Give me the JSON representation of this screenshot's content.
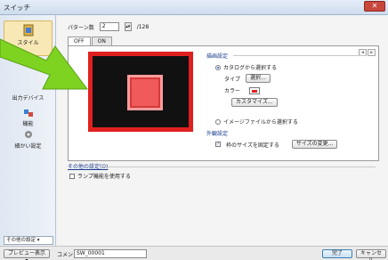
{
  "window": {
    "title": "スイッチ",
    "close_glyph": "✕"
  },
  "sidebar": {
    "items": [
      {
        "label": "スタイル",
        "icon": "style-icon"
      },
      {
        "label": "出力デバイス",
        "icon": "output-device-icon"
      },
      {
        "label": "機能",
        "icon": "function-icon"
      },
      {
        "label": "細かい設定",
        "icon": "gear-icon"
      }
    ],
    "footer": "その他の設定 ▾"
  },
  "pattern": {
    "label": "パターン数",
    "value": "2",
    "spin": "▴▾",
    "max": "/128"
  },
  "tabs": [
    "OFF",
    "ON"
  ],
  "scroll": {
    "left": "◂",
    "right": "▸"
  },
  "image_settings": {
    "title": "描画設定",
    "catalog_radio": "カタログから選択する",
    "type_label": "タイプ",
    "select_button": "選択...",
    "color_label": "カラー",
    "custom_button": "カスタマイズ...",
    "image_file_radio": "イメージファイルから選択する"
  },
  "size_settings": {
    "title": "外観設定",
    "fix_size_check": "枠のサイズを固定する",
    "change_size_button": "サイズの変更..."
  },
  "other_settings": {
    "link": "その他の設定(O)",
    "lamp_check": "ランプ機能を使用する"
  },
  "bottom": {
    "preview_button": "プレビュー表示 ▾",
    "comment_label": "コメント",
    "comment_value": "SW_00001",
    "ok_button": "完了",
    "cancel_button": "キャンセル"
  },
  "colors": {
    "accent_red": "#e02020",
    "lamp_red": "#f05a5a",
    "arrow_green": "#7ed321"
  }
}
